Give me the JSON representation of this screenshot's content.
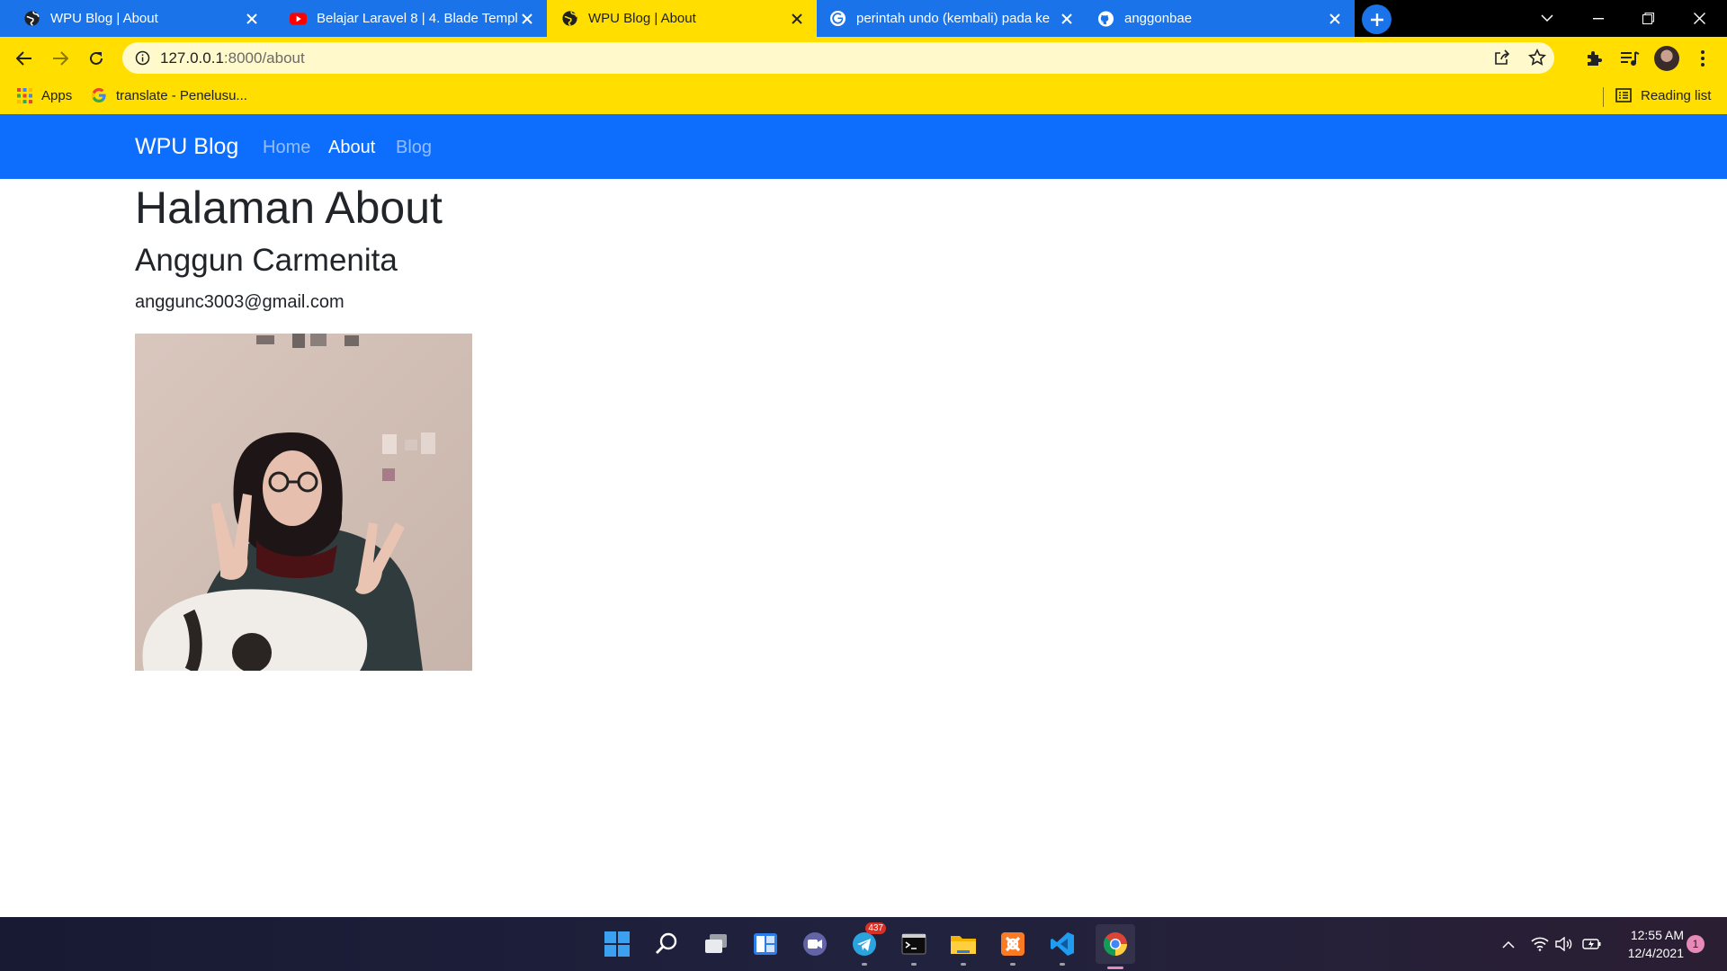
{
  "browser": {
    "tabs": [
      {
        "title": "WPU Blog | About",
        "icon": "globe-icon",
        "active": false
      },
      {
        "title": "Belajar Laravel 8 | 4. Blade Templ",
        "icon": "youtube-icon",
        "active": false
      },
      {
        "title": "WPU Blog | About",
        "icon": "globe-icon",
        "active": true
      },
      {
        "title": "perintah undo (kembali) pada ke",
        "icon": "google-icon",
        "active": false
      },
      {
        "title": "anggonbae",
        "icon": "github-icon",
        "active": false
      }
    ],
    "url_host": "127.0.0.1",
    "url_rest": ":8000/about",
    "bookmarks": {
      "apps": "Apps",
      "translate": "translate - Penelusu...",
      "reading_list": "Reading list"
    }
  },
  "page": {
    "brand": "WPU Blog",
    "nav": [
      {
        "label": "Home",
        "active": false
      },
      {
        "label": "About",
        "active": true
      },
      {
        "label": "Blog",
        "active": false
      }
    ],
    "heading": "Halaman About",
    "name": "Anggun Carmenita",
    "email": "anggunc3003@gmail.com"
  },
  "taskbar": {
    "telegram_badge": "437",
    "time": "12:55 AM",
    "date": "12/4/2021",
    "notifications": "1"
  },
  "colors": {
    "chrome_accent": "#ffde00",
    "tab_inactive": "#1a73e8",
    "navbar": "#0d6efd"
  }
}
